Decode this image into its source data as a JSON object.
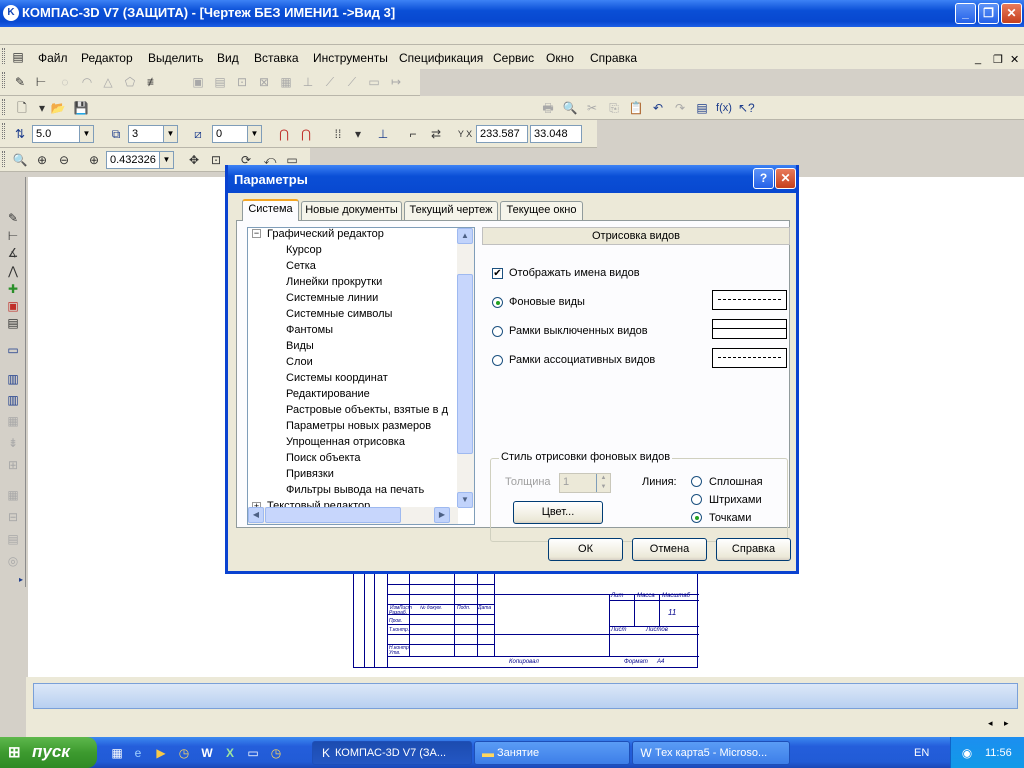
{
  "window": {
    "title": "КОМПАС-3D V7 (ЗАЩИТА) - [Чертеж БЕЗ ИМЕНИ1 ->Вид 3]"
  },
  "menu": {
    "items": [
      "Файл",
      "Редактор",
      "Выделить",
      "Вид",
      "Вставка",
      "Инструменты",
      "Спецификация",
      "Сервис",
      "Окно",
      "Справка"
    ]
  },
  "toolbar": {
    "step_value": "5.0",
    "layer_value": "3",
    "style_value": "0",
    "coord_x": "233.587",
    "coord_y": "33.048",
    "zoom_value": "0.432326"
  },
  "dialog": {
    "title": "Параметры",
    "tabs": [
      "Система",
      "Новые документы",
      "Текущий чертеж",
      "Текущее окно"
    ],
    "tree": {
      "root": "Графический редактор",
      "children": [
        "Курсор",
        "Сетка",
        "Линейки прокрутки",
        "Системные линии",
        "Системные символы",
        "Фантомы",
        "Виды",
        "Слои",
        "Системы координат",
        "Редактирование",
        "Растровые объекты, взятые в д",
        "Параметры новых размеров",
        "Упрощенная отрисовка",
        "Поиск объекта",
        "Привязки",
        "Фильтры вывода на печать"
      ],
      "next": "Текстовый редактор"
    },
    "section_header": "Отрисовка видов",
    "show_names_label": "Отображать имена видов",
    "radio_background": "Фоновые виды",
    "radio_off_frames": "Рамки выключенных видов",
    "radio_assoc_frames": "Рамки ассоциативных видов",
    "group_title": "Стиль отрисовки фоновых видов",
    "thickness_label": "Толщина",
    "thickness_value": "1",
    "line_label": "Линия:",
    "line_solid": "Сплошная",
    "line_dash": "Штрихами",
    "line_dots": "Точками",
    "color_button": "Цвет...",
    "ok": "ОК",
    "cancel": "Отмена",
    "help": "Справка"
  },
  "drawing": {
    "stamp_11": "11",
    "copied": "Копировал",
    "format": "Формат",
    "format_value": "A4",
    "sheet": "Лист",
    "sheets": "Листов",
    "lit": "Лит",
    "mass": "Масса",
    "scale": "Масштаб",
    "labels": [
      "Изм",
      "Лист",
      "№ докум.",
      "Подп.",
      "Дата",
      "Разраб.",
      "Пров.",
      "Т.контр.",
      "Н.контр.",
      "Утв."
    ]
  },
  "taskbar": {
    "start": "пуск",
    "tasks": [
      "КОМПАС-3D V7 (ЗА...",
      "Занятие",
      "Тех карта5 - Microso..."
    ],
    "lang": "EN",
    "clock": "11:56"
  }
}
